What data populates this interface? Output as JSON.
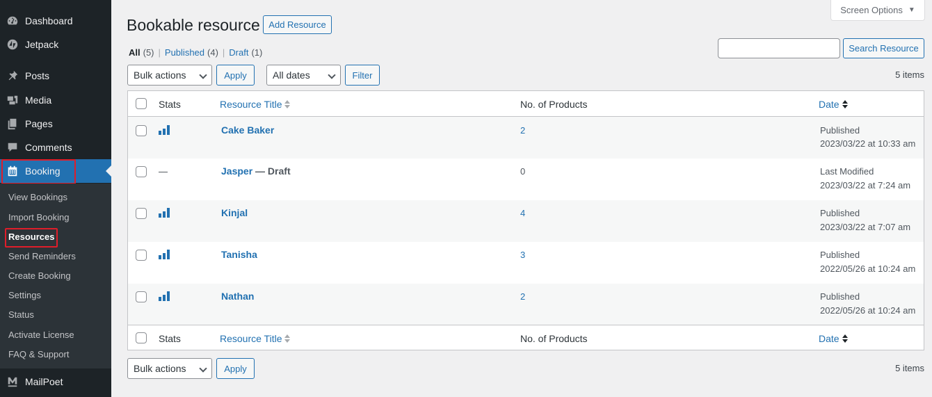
{
  "sidebar": {
    "top_items": [
      {
        "label": "Dashboard",
        "icon": "dashboard-icon"
      },
      {
        "label": "Jetpack",
        "icon": "jetpack-icon"
      },
      {
        "label": "Posts",
        "icon": "pin-icon"
      },
      {
        "label": "Media",
        "icon": "media-icon"
      },
      {
        "label": "Pages",
        "icon": "pages-icon"
      },
      {
        "label": "Comments",
        "icon": "comment-icon"
      },
      {
        "label": "Booking",
        "icon": "calendar-icon"
      }
    ],
    "submenu": [
      {
        "label": "View Bookings"
      },
      {
        "label": "Import Booking"
      },
      {
        "label": "Resources"
      },
      {
        "label": "Send Reminders"
      },
      {
        "label": "Create Booking"
      },
      {
        "label": "Settings"
      },
      {
        "label": "Status"
      },
      {
        "label": "Activate License"
      },
      {
        "label": "FAQ & Support"
      }
    ],
    "bottom_item": {
      "label": "MailPoet",
      "icon": "mailpoet-icon"
    },
    "active_color": "#2271b1",
    "highlight_color": "#e01d2a"
  },
  "header": {
    "title": "Bookable resource",
    "add_button": "Add Resource",
    "screen_options": "Screen Options"
  },
  "views": [
    {
      "label": "All",
      "count": "(5)"
    },
    {
      "label": "Published",
      "count": "(4)"
    },
    {
      "label": "Draft",
      "count": "(1)"
    }
  ],
  "search": {
    "button": "Search Resource",
    "value": ""
  },
  "toolbar": {
    "bulk_actions": "Bulk actions",
    "apply": "Apply",
    "dates": "All dates",
    "filter": "Filter",
    "items_count": "5 items"
  },
  "table": {
    "columns": {
      "stats": "Stats",
      "title": "Resource Title",
      "products": "No. of Products",
      "date": "Date"
    },
    "rows": [
      {
        "title": "Cake Baker",
        "state": "",
        "stats": "stats-icon",
        "products": "2",
        "status": "Published",
        "date": "2023/03/22 at 10:33 am"
      },
      {
        "title": "Jasper",
        "state": " — Draft",
        "stats": "—",
        "products": "0",
        "status": "Last Modified",
        "date": "2023/03/22 at 7:24 am"
      },
      {
        "title": "Kinjal",
        "state": "",
        "stats": "stats-icon",
        "products": "4",
        "status": "Published",
        "date": "2023/03/22 at 7:07 am"
      },
      {
        "title": "Tanisha",
        "state": "",
        "stats": "stats-icon",
        "products": "3",
        "status": "Published",
        "date": "2022/05/26 at 10:24 am"
      },
      {
        "title": "Nathan",
        "state": "",
        "stats": "stats-icon",
        "products": "2",
        "status": "Published",
        "date": "2022/05/26 at 10:24 am"
      }
    ]
  },
  "bottom_toolbar": {
    "bulk_actions": "Bulk actions",
    "apply": "Apply",
    "items_count": "5 items"
  }
}
